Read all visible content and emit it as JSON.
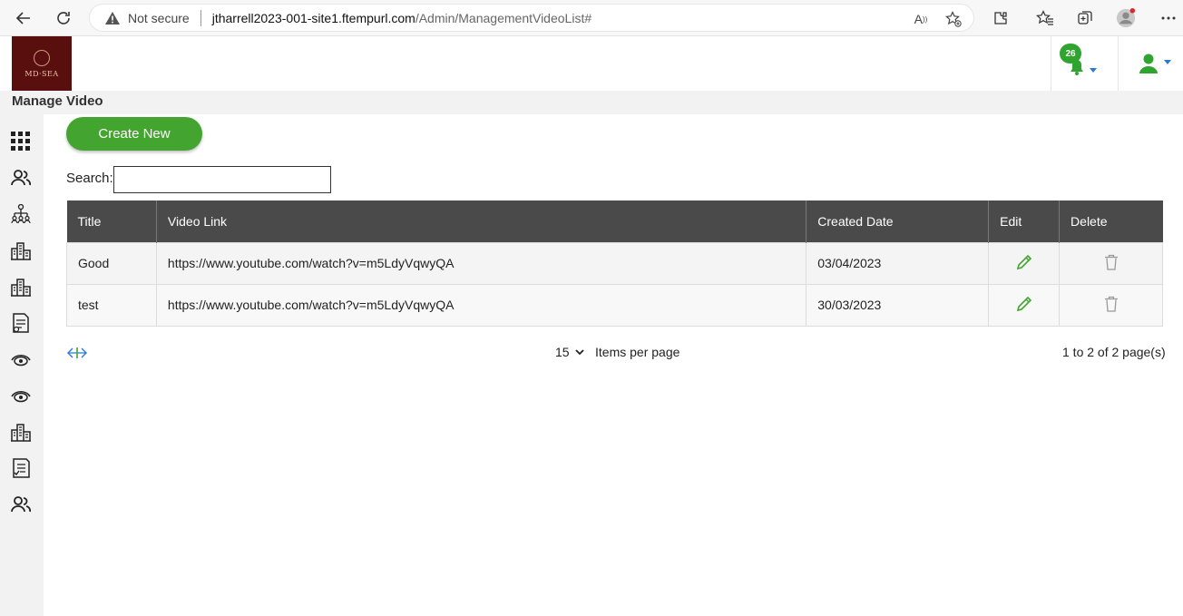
{
  "browser": {
    "not_secure": "Not secure",
    "url_host": "jtharrell2023-001-site1.ftempurl.com",
    "url_path": "/Admin/ManagementVideoList#"
  },
  "header": {
    "logo_text": "MD·SEA",
    "notification_count": "26"
  },
  "page": {
    "title": "Manage Video",
    "create_label": "Create New",
    "search_label": "Search:",
    "search_value": ""
  },
  "sidebar": {
    "icons": [
      "grid-icon",
      "users-icon",
      "org-chart-icon",
      "buildings-icon",
      "buildings-icon",
      "document-icon",
      "vision-icon",
      "vision-icon",
      "buildings-icon",
      "checklist-icon",
      "users-icon"
    ]
  },
  "table": {
    "headers": {
      "title": "Title",
      "video_link": "Video Link",
      "created_date": "Created Date",
      "edit": "Edit",
      "delete": "Delete"
    },
    "rows": [
      {
        "title": "Good",
        "video_link": "https://www.youtube.com/watch?v=m5LdyVqwyQA",
        "created_date": "03/04/2023"
      },
      {
        "title": "test",
        "video_link": "https://www.youtube.com/watch?v=m5LdyVqwyQA",
        "created_date": "30/03/2023"
      }
    ]
  },
  "pager": {
    "page_size": "15",
    "items_per_page": "Items per page",
    "info": "1 to 2 of 2 page(s)"
  },
  "colors": {
    "accent_green": "#43a52f",
    "header_dark": "#4a4a4a",
    "logo_bg": "#5a0f0f"
  }
}
